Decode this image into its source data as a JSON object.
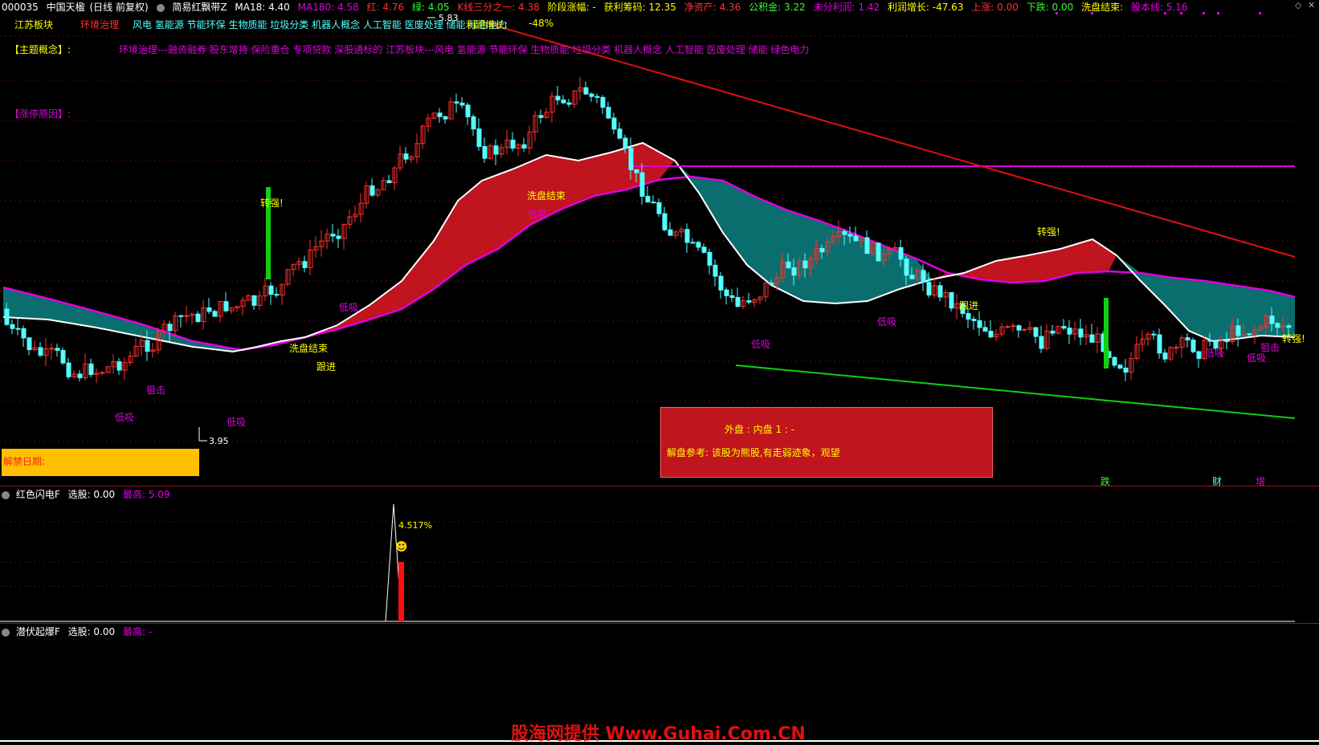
{
  "header": {
    "code": "000035",
    "name": "中国天楹",
    "period": "(日线 前复权)",
    "indicator": "简易红飘带Z",
    "ma18": "MA18: 4.40",
    "ma180": "MA180: 4.58",
    "red": "红: 4.76",
    "green": "绿: 4.05",
    "kline": "K线三分之一: 4.38",
    "stage_gain": "阶段涨幅: -",
    "profit_chips": "获利筹码: 12.35",
    "net_assets": "净资产: 4.36",
    "reserve": "公积金: 3.22",
    "undistributed": "未分利润: 1.42",
    "profit_growth": "利润增长: -47.63",
    "up": "上涨: 0.00",
    "down": "下跌: 0.00",
    "wash_end": "洗盘结束:",
    "cost_line": "股本线: 5.16"
  },
  "colors": {
    "up_candle": "#ff3030",
    "down_candle": "#54ffff",
    "ribbon_red": "#c0141e",
    "ribbon_teal": "#0a6e6e",
    "magenta": "#e000e0",
    "white_line": "#ffffff",
    "trend_red": "#e01010",
    "trend_green": "#10d010",
    "yellow": "#ffff00"
  },
  "info": {
    "sector_label": "江苏板块",
    "sector_tag": "环境治理",
    "sector_concepts": "风电 氢能源 节能环保 生物质能 垃圾分类 机器人概念 人工智能 医废处理 储能 绿色电力",
    "profit_growth_label": "利润增长:",
    "profit_growth_value": "-48%",
    "theme_label": "【主题概念】:",
    "theme_text": "环境治理---融资融券 股东增持 保险重仓 专项贷款 深股通标的 江苏板块---风电 氢能源 节能环保 生物质能 垃圾分类 机器人概念 人工智能 医废处理 储能 绿色电力",
    "limit_reason_label": "【涨停原因】:",
    "high_price": "5.83",
    "low_price": "3.95",
    "lift_label": "解禁日期:",
    "inner_outer": "外盘 : 内盘   1  :  -",
    "advice": "解盘参考: 该股为熊股,有走弱迹象，观望"
  },
  "signals": {
    "zhuanqiang": "转强!",
    "xipan": "洗盘结束",
    "dixi": "低吸",
    "genjin": "跟进",
    "zuji": "狙击",
    "die": "跌",
    "cai": "财",
    "zeng": "增"
  },
  "panel2": {
    "title": "红色闪电F",
    "select": "选股: 0.00",
    "max": "最高: 5.09",
    "peak_label": "4.517%"
  },
  "panel3": {
    "title": "潜伏起爆F",
    "select": "选股: 0.00",
    "max": "最高: -"
  },
  "watermark": "股海网提供 Www.Guhai.Com.CN"
}
